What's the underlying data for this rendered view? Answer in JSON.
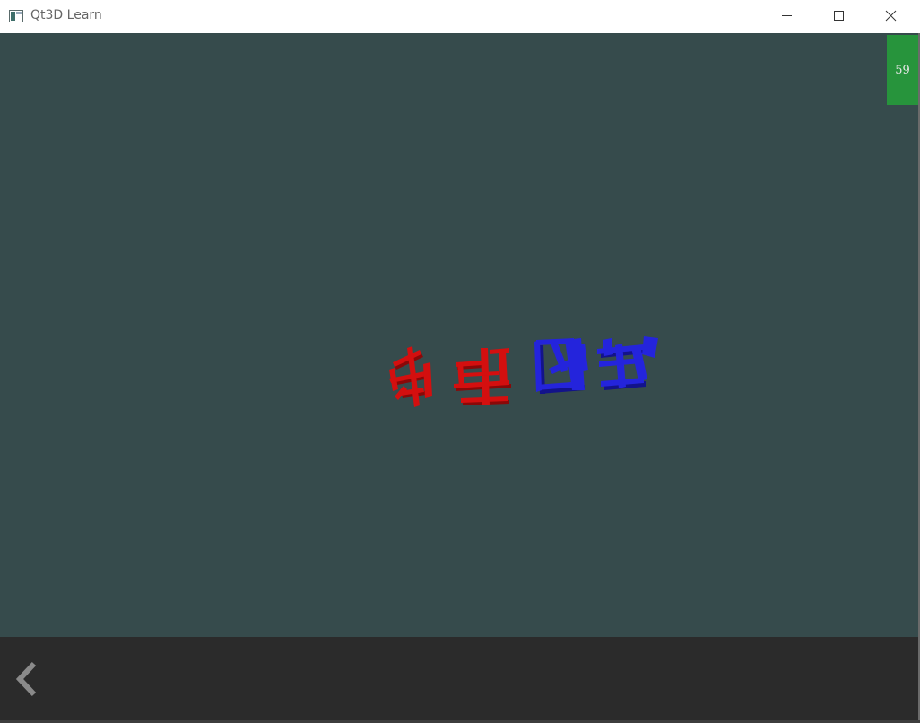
{
  "window": {
    "title": "Qt3D Learn"
  },
  "titlebar": {
    "buttons": [
      {
        "name": "minimize",
        "icon": "minimize-icon"
      },
      {
        "name": "maximize",
        "icon": "maximize-icon"
      },
      {
        "name": "close",
        "icon": "close-icon"
      }
    ]
  },
  "viewport": {
    "background_color": "#364b4c",
    "fps_counter": "59",
    "fps_badge_color": "#27943c",
    "scene_objects": [
      {
        "name": "red-3d-text",
        "color": "#d40f0f"
      },
      {
        "name": "blue-3d-text",
        "color": "#2424dc"
      }
    ]
  },
  "bottom_bar": {
    "background_color": "#2b2b2b",
    "back_icon": "chevron-left-icon"
  }
}
